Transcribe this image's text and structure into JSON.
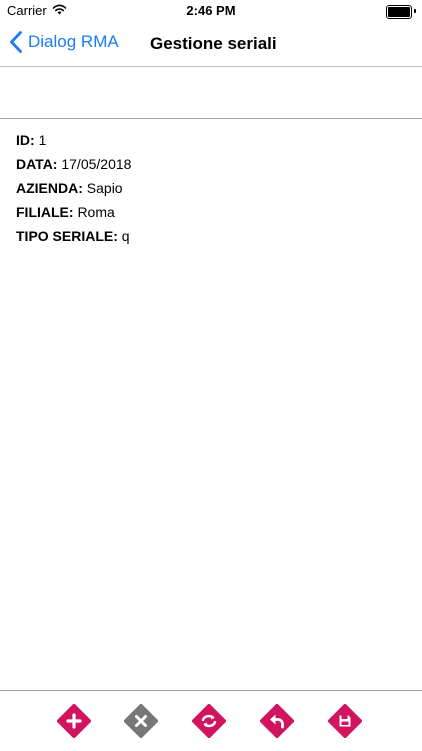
{
  "status_bar": {
    "carrier": "Carrier",
    "time": "2:46 PM"
  },
  "nav": {
    "back_label": "Dialog RMA",
    "title": "Gestione seriali"
  },
  "details": [
    {
      "key": "ID:",
      "value": "1"
    },
    {
      "key": "DATA:",
      "value": "17/05/2018"
    },
    {
      "key": "AZIENDA:",
      "value": "Sapio"
    },
    {
      "key": "FILIALE:",
      "value": "Roma"
    },
    {
      "key": "TIPO SERIALE:",
      "value": "q"
    }
  ],
  "toolbar": {
    "buttons": [
      "plus-icon",
      "close-icon",
      "refresh-icon",
      "undo-icon",
      "save-icon"
    ],
    "colors": {
      "accent": "#d0145f",
      "disabled": "#777777"
    }
  }
}
